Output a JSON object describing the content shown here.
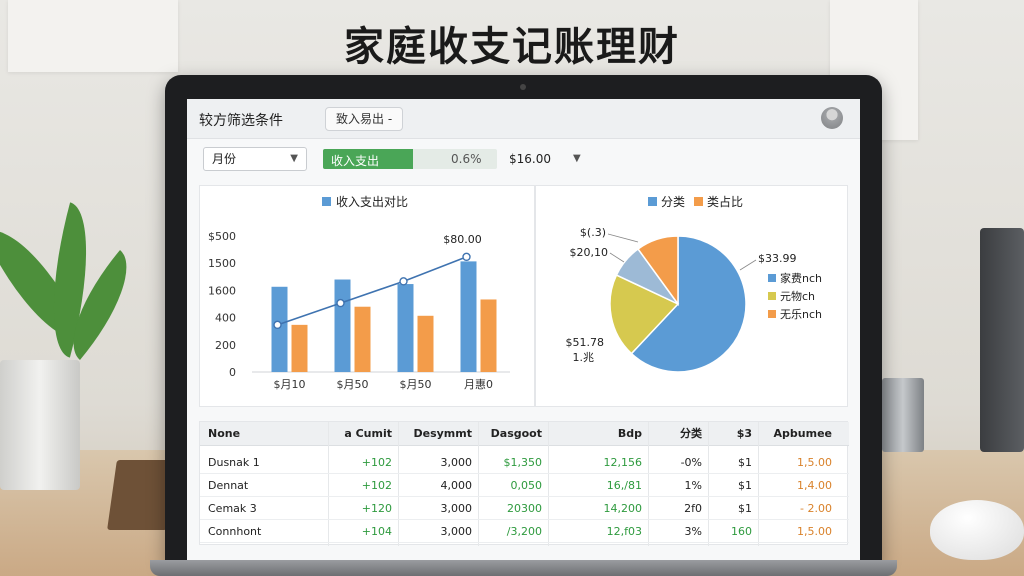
{
  "headline": "家庭收支记账理财",
  "toolbar": {
    "title": "较方筛选条件",
    "button_label": "致入易出 -"
  },
  "filter": {
    "month_select": "月份",
    "progress_label": "收入支出",
    "progress_value": "0.6%",
    "progress_fraction": 0.52,
    "amount": "$16.00"
  },
  "colors": {
    "blue": "#5b9bd5",
    "orange": "#f39c4a",
    "yellow": "#d6c94f",
    "light_blue": "#9dbad6",
    "green": "#4aa657"
  },
  "chart_data": [
    {
      "type": "bar",
      "title": "收入支出对比",
      "legend": [
        "收入支出对比"
      ],
      "legend_placement": "top",
      "categories": [
        "$月10",
        "$月50",
        "$月50",
        "月惠0"
      ],
      "y_ticks": [
        "0",
        "200",
        "400",
        "1600",
        "1500",
        "$500"
      ],
      "series": [
        {
          "name": "收入支出对比",
          "color": "#5b9bd5",
          "values": [
            940,
            1020,
            970,
            1220
          ]
        },
        {
          "name": "",
          "color": "#f39c4a",
          "values": [
            520,
            720,
            620,
            800
          ]
        }
      ],
      "line": {
        "values": [
          520,
          760,
          1000,
          1270
        ],
        "color": "#3f73b0",
        "label": "$80.00"
      },
      "ylim": [
        0,
        1500
      ],
      "grid": false
    },
    {
      "type": "pie",
      "legend": [
        "分类",
        "类占比"
      ],
      "legend_placement": "top",
      "slices": [
        {
          "label": "家费nch",
          "value": 62,
          "color": "#5b9bd5"
        },
        {
          "label": "元物ch",
          "value": 20,
          "color": "#d6c94f"
        },
        {
          "label": "",
          "value": 8,
          "color": "#9dbad6"
        },
        {
          "label": "无乐nch",
          "value": 10,
          "color": "#f39c4a"
        }
      ],
      "callouts": [
        "$(.3)",
        "$20,10",
        "$33.99",
        "$51.78",
        "1.兆"
      ]
    }
  ],
  "table": {
    "headers": [
      "None",
      "a Cumit",
      "Desymmt",
      "Dasgoot",
      "Bdp",
      "分类",
      "$3",
      "Apbumee"
    ],
    "rows": [
      [
        "Dusnak 1",
        "+102",
        "3,000",
        "$1,350",
        "12,156",
        "-0%",
        "$1",
        "1,5.00"
      ],
      [
        "Dennat",
        "+102",
        "4,000",
        "0,050",
        "16,/81",
        "1%",
        "$1",
        "1,4.00"
      ],
      [
        "Cemak 3",
        "+120",
        "3,000",
        "20300",
        "14,200",
        "2f0",
        "$1",
        "- 2.00"
      ],
      [
        "Connhont",
        "+104",
        "3,000",
        "/3,200",
        "12,f03",
        "3%",
        "160",
        "1,5.00"
      ]
    ]
  }
}
